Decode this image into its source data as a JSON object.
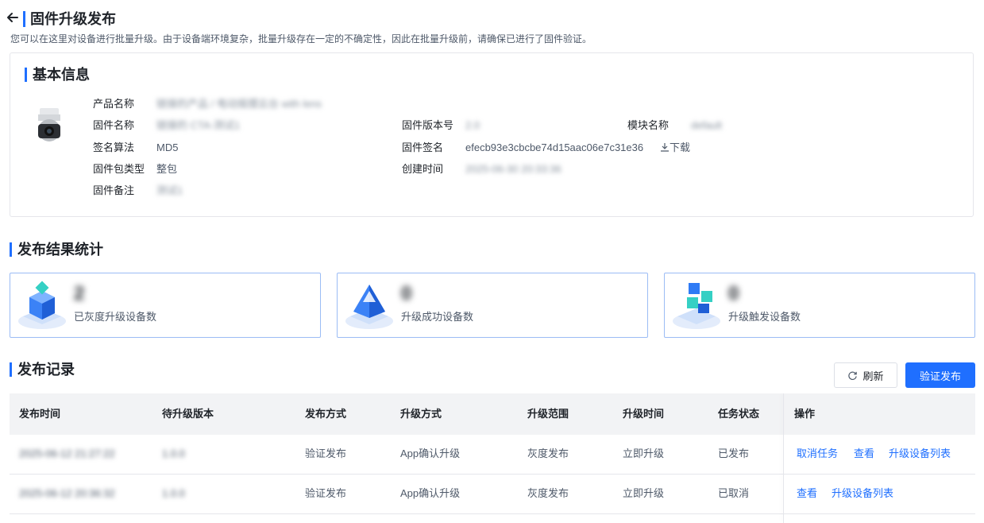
{
  "header": {
    "title": "固件升级发布",
    "description": "您可以在这里对设备进行批量升级。由于设备端环境复杂，批量升级存在一定的不确定性，因此在批量升级前，请确保已进行了固件验证。"
  },
  "basic_info": {
    "section_title": "基本信息",
    "fields": {
      "product_name_label": "产品名称",
      "product_name_value": "链接的产品 / 电动摇摆云台 with lens",
      "firmware_name_label": "固件名称",
      "firmware_name_value": "链接的 CTA-测试1",
      "signature_algo_label": "签名算法",
      "signature_algo_value": "MD5",
      "package_type_label": "固件包类型",
      "package_type_value": "整包",
      "remark_label": "固件备注",
      "remark_value": "测试1",
      "version_label": "固件版本号",
      "version_value": "2.0",
      "signature_label": "固件签名",
      "signature_value": "efecb93e3cbcbe74d15aac06e7c31e36",
      "download_label": "下载",
      "created_label": "创建时间",
      "created_value": "2025-06-30 20:33:36",
      "module_label": "模块名称",
      "module_value": "default"
    }
  },
  "stats": {
    "section_title": "发布结果统计",
    "cards": [
      {
        "value": "2",
        "label": "已灰度升级设备数",
        "icon": "cube-stack-icon"
      },
      {
        "value": "0",
        "label": "升级成功设备数",
        "icon": "pyramid-icon"
      },
      {
        "value": "0",
        "label": "升级触发设备数",
        "icon": "blocks-icon"
      }
    ]
  },
  "records": {
    "section_title": "发布记录",
    "refresh_label": "刷新",
    "publish_label": "验证发布",
    "columns": [
      "发布时间",
      "待升级版本",
      "发布方式",
      "升级方式",
      "升级范围",
      "升级时间",
      "任务状态",
      "操作"
    ],
    "rows": [
      {
        "time": "2025-06-12 21:27:22",
        "version": "1.0.0",
        "method": "验证发布",
        "upgrade_mode": "App确认升级",
        "scope": "灰度发布",
        "upgrade_time": "立即升级",
        "status": "已发布",
        "actions": [
          "取消任务",
          "查看",
          "升级设备列表"
        ]
      },
      {
        "time": "2025-06-12 20:36:32",
        "version": "1.0.0",
        "method": "验证发布",
        "upgrade_mode": "App确认升级",
        "scope": "灰度发布",
        "upgrade_time": "立即升级",
        "status": "已取消",
        "actions": [
          "查看",
          "升级设备列表"
        ]
      }
    ]
  }
}
